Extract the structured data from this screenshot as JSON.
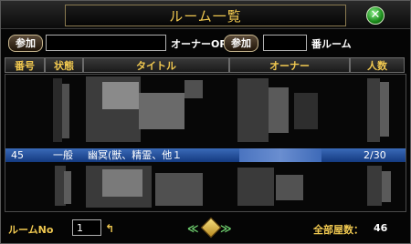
{
  "title": "ルーム一覧",
  "toolbar": {
    "join_label_1": "参加",
    "room_input_1": "",
    "owner_or_label": "オーナーOR",
    "join_label_2": "参加",
    "room_input_2": "",
    "room_number_label": "番ルーム"
  },
  "table": {
    "headers": [
      "番号",
      "状態",
      "タイトル",
      "オーナー",
      "人数"
    ],
    "selected_row": {
      "number": "45",
      "status": "一般",
      "title": "幽冥(獣、精霊、他１",
      "owner": "",
      "count": "2/30"
    }
  },
  "footer": {
    "room_no_label": "ルームNo",
    "room_no_value": "1",
    "total_label": "全部屋数：",
    "total_value": "46"
  },
  "colors": {
    "accent_gold": "#f0c850",
    "selection_blue": "#2a5aa8",
    "nav_green": "#6fd06f"
  },
  "icons": {
    "close": "close-icon",
    "back": "return-arrow-icon",
    "prev": "double-left-arrow-icon",
    "next": "double-right-arrow-icon",
    "refresh": "diamond-refresh-icon"
  }
}
